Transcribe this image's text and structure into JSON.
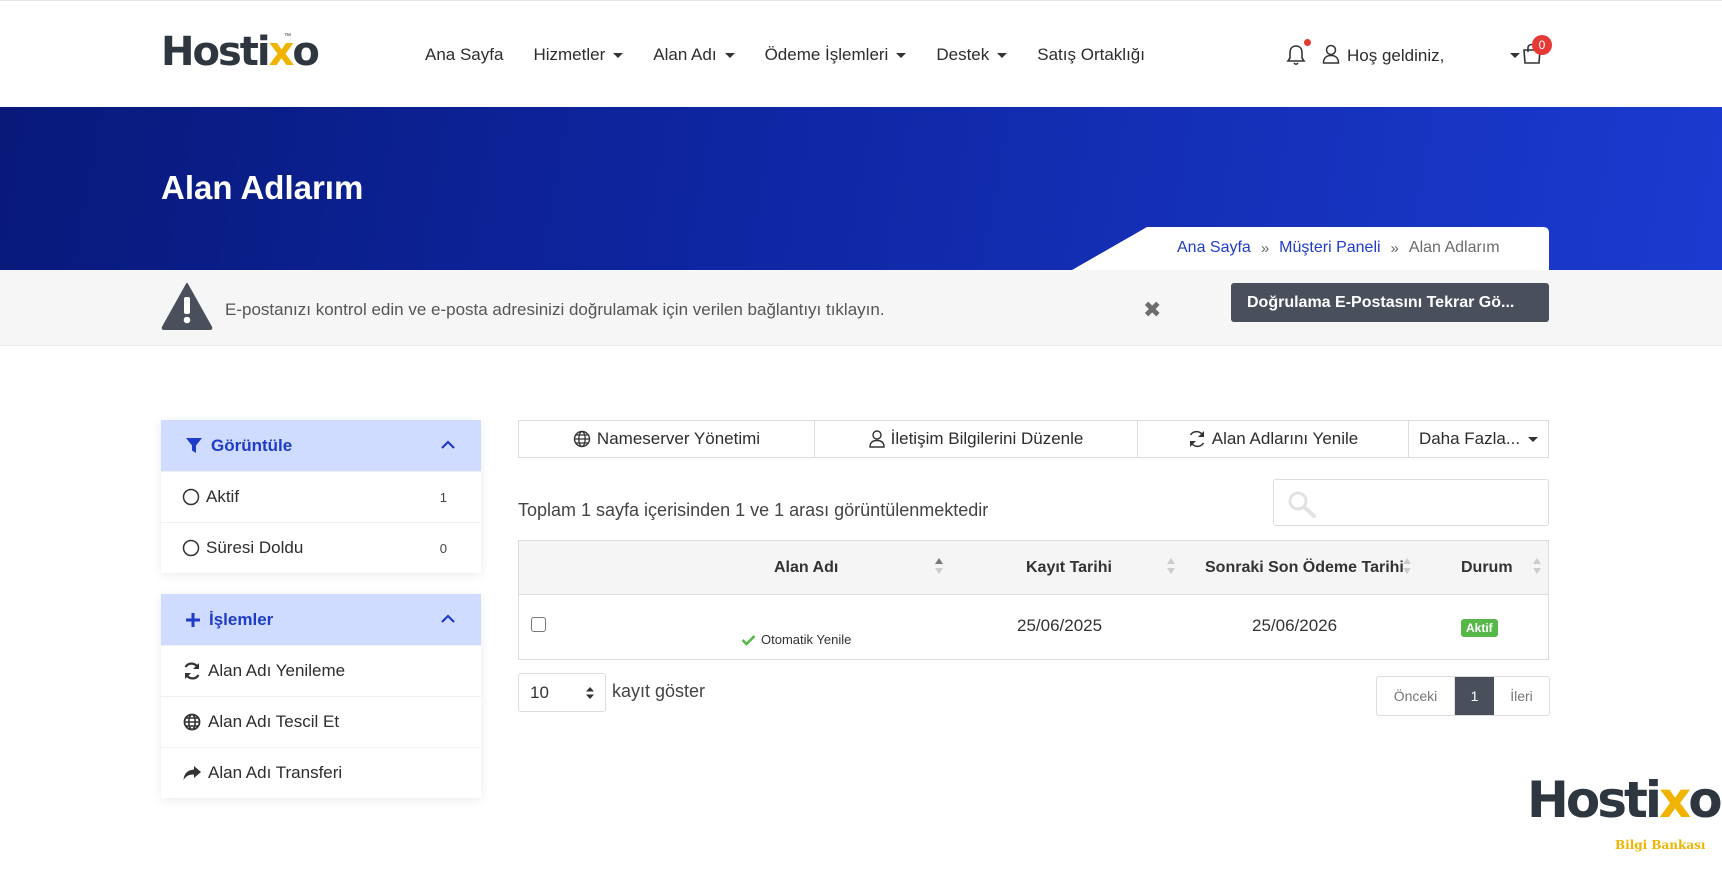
{
  "brand": {
    "logo_main": "Hosti",
    "logo_accent": "x",
    "logo_end": "o",
    "tm": "™"
  },
  "nav": {
    "items": [
      {
        "label": "Ana Sayfa",
        "dropdown": false
      },
      {
        "label": "Hizmetler",
        "dropdown": true
      },
      {
        "label": "Alan Adı",
        "dropdown": true
      },
      {
        "label": "Ödeme İşlemleri",
        "dropdown": true
      },
      {
        "label": "Destek",
        "dropdown": true
      },
      {
        "label": "Satış Ortaklığı",
        "dropdown": false
      }
    ],
    "welcome": "Hoş geldiniz,",
    "cart_count": "0"
  },
  "banner": {
    "title": "Alan Adlarım",
    "breadcrumb": {
      "home": "Ana Sayfa",
      "panel": "Müşteri Paneli",
      "current": "Alan Adlarım"
    }
  },
  "alert": {
    "text": "E-postanızı kontrol edin ve e-posta adresinizi doğrulamak için verilen bağlantıyı tıklayın.",
    "close": "✖",
    "button": "Doğrulama E-Postasını Tekrar Gö..."
  },
  "sidebar": {
    "filter_title": "Görüntüle",
    "filters": [
      {
        "label": "Aktif",
        "count": "1"
      },
      {
        "label": "Süresi Doldu",
        "count": "0"
      }
    ],
    "actions_title": "İşlemler",
    "actions": [
      {
        "label": "Alan Adı Yenileme",
        "icon": "refresh-icon"
      },
      {
        "label": "Alan Adı Tescil Et",
        "icon": "globe-icon"
      },
      {
        "label": "Alan Adı Transferi",
        "icon": "share-icon"
      }
    ]
  },
  "toolbar": {
    "nameserver": "Nameserver Yönetimi",
    "contact": "İletişim Bilgilerini Düzenle",
    "renew": "Alan Adlarını Yenile",
    "more": "Daha Fazla..."
  },
  "table": {
    "info": "Toplam 1 sayfa içerisinden 1 ve 1 arası görüntülenmektedir",
    "search_value": "",
    "columns": [
      "Alan Adı",
      "Kayıt Tarihi",
      "Sonraki Son Ödeme Tarihi",
      "Durum"
    ],
    "rows": [
      {
        "domain": "",
        "auto_renew": "Otomatik Yenile",
        "registered": "25/06/2025",
        "next_due": "25/06/2026",
        "status": "Aktif"
      }
    ],
    "page_length": "10",
    "page_length_label": "kayıt göster",
    "pager": {
      "prev": "Önceki",
      "current": "1",
      "next": "İleri"
    }
  },
  "watermark": {
    "main": "Hosti",
    "accent": "x",
    "end": "o",
    "sub": "Bilgi Bankası"
  },
  "colors": {
    "primary": "#1e3cc8",
    "banner_dark": "#08197a",
    "accent": "#f0b400",
    "success": "#55b848",
    "dark_button": "#4a4f5c",
    "danger": "#e53935"
  }
}
